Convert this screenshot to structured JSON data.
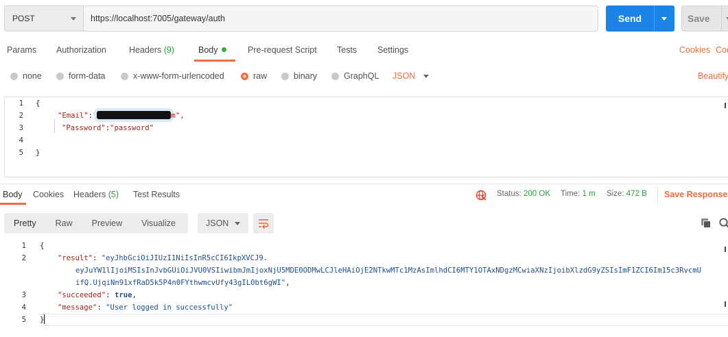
{
  "request": {
    "method": "POST",
    "url": "https://localhost:7005/gateway/auth",
    "send_label": "Send",
    "save_label": "Save"
  },
  "request_tabs": {
    "params": "Params",
    "authorization": "Authorization",
    "headers": "Headers",
    "headers_count": "(9)",
    "body": "Body",
    "pre_request": "Pre-request Script",
    "tests": "Tests",
    "settings": "Settings",
    "cookies": "Cookies",
    "code": "Code"
  },
  "body_types": {
    "none": "none",
    "form_data": "form-data",
    "urlencoded": "x-www-form-urlencoded",
    "raw": "raw",
    "binary": "binary",
    "graphql": "GraphQL",
    "format": "JSON",
    "beautify": "Beautify",
    "selected": "raw"
  },
  "request_body": {
    "line_numbers": [
      "1",
      "2",
      "3",
      "4",
      "5"
    ],
    "open_brace": "{",
    "email_key": "\"Email\"",
    "colon": ":",
    "email_value_start": "\"",
    "email_value_end": "m\",",
    "password_key": "\"Password\"",
    "password_value": "\"password\"",
    "close_brace": "}"
  },
  "response_tabs": {
    "body": "Body",
    "cookies": "Cookies",
    "headers": "Headers",
    "headers_count": "(5)",
    "test_results": "Test Results",
    "status_label": "Status:",
    "status_value": "200 OK",
    "time_label": "Time:",
    "time_value": "1 m",
    "size_label": "Size:",
    "size_value": "472 B",
    "save_response": "Save Response"
  },
  "response_toolbar": {
    "pretty": "Pretty",
    "raw": "Raw",
    "preview": "Preview",
    "visualize": "Visualize",
    "format": "JSON"
  },
  "response_body": {
    "line_numbers": [
      "1",
      "2",
      "3",
      "4",
      "5"
    ],
    "open_brace": "{",
    "result_key": "\"result\"",
    "result_value_1": "\"eyJhbGciOiJIUzI1NiIsInR5cCI6IkpXVCJ9.",
    "result_value_2": "eyJuYW1lIjoiMSIsInJvbGUiOiJVU0VSIiwibmJmIjoxNjU5MDE0ODMwLCJleHAiOjE2NTkwMTc1MzAsImlhdCI6MTY1OTAxNDgzMCwiaXNzIjoibXlzdG9yZSIsImF1ZCI6Im15c3RvcmU",
    "result_value_3": "ifQ.UjqiNn91xfRaD5k5P4n0FYthwmcvUfy43gIL0bt6gWI\"",
    "succeeded_key": "\"succeeded\"",
    "succeeded_value": "true",
    "message_key": "\"message\"",
    "message_value": "\"User logged in successfully\"",
    "close_brace": "}"
  },
  "colors": {
    "accent_orange": "#f26b3a",
    "send_blue": "#1a84e8",
    "success_green": "#2a9d3a"
  }
}
